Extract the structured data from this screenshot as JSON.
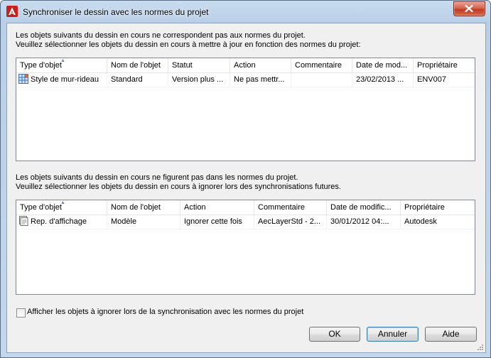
{
  "window": {
    "title": "Synchroniser le dessin avec les normes du projet"
  },
  "section1": {
    "message_line1": "Les objets suivants du dessin en cours ne correspondent pas aux normes du projet.",
    "message_line2": "Veuillez sélectionner les objets du dessin en cours à mettre à jour en fonction des normes du projet:",
    "columns": [
      "Type d'objet",
      "Nom de l'objet",
      "Statut",
      "Action",
      "Commentaire",
      "Date de mod...",
      "Propriétaire"
    ],
    "rows": [
      {
        "type": "Style de mur-rideau",
        "name": "Standard",
        "status": "Version plus ...",
        "action": "Ne pas mettr...",
        "comment": "",
        "date": "23/02/2013 ...",
        "owner": "ENV007",
        "icon": "curtain-wall-style-icon"
      }
    ]
  },
  "section2": {
    "message_line1": "Les objets suivants du dessin en cours ne figurent pas dans les normes du projet.",
    "message_line2": "Veuillez sélectionner les objets du dessin en cours à ignorer lors des synchronisations futures.",
    "columns": [
      "Type d'objet",
      "Nom de l'objet",
      "Action",
      "Commentaire",
      "Date de modific...",
      "Propriétaire"
    ],
    "rows": [
      {
        "type": "Rep. d'affichage",
        "name": "Modèle",
        "action": "Ignorer cette fois",
        "comment": "AecLayerStd - 2...",
        "date": "30/01/2012 04:...",
        "owner": "Autodesk",
        "icon": "display-rep-icon"
      }
    ]
  },
  "checkbox": {
    "label": "Afficher les objets à ignorer lors de la synchronisation avec les normes du projet",
    "checked": false
  },
  "buttons": {
    "ok": "OK",
    "cancel": "Annuler",
    "help": "Aide"
  },
  "colors": {
    "app_icon_red": "#c8201e",
    "close_button": "#c84b35",
    "focus_border": "#3c7fb1"
  }
}
